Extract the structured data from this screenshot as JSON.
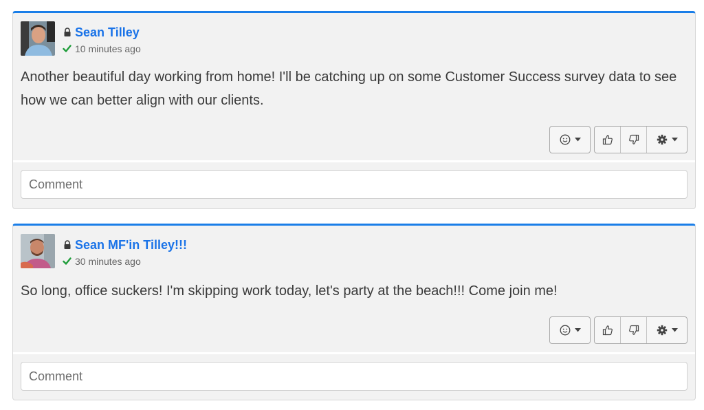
{
  "posts": [
    {
      "author": "Sean Tilley",
      "time": "10 minutes ago",
      "body": "Another beautiful day working from home! I'll be catching up on some Customer Success survey data to see how we can better align with our clients.",
      "comment_placeholder": "Comment"
    },
    {
      "author": "Sean MF'in Tilley!!!",
      "time": "30 minutes ago",
      "body": "So long, office suckers! I'm skipping work today, let's party at the beach!!! Come join me!",
      "comment_placeholder": "Comment"
    }
  ],
  "colors": {
    "accent": "#1a7ee8",
    "author_link": "#1a73e8",
    "check": "#1f9d3a",
    "card_bg": "#f2f2f2"
  },
  "icons": [
    "lock-icon",
    "check-icon",
    "smiley-icon",
    "caret-down-icon",
    "thumbs-up-icon",
    "thumbs-down-icon",
    "gear-icon"
  ]
}
